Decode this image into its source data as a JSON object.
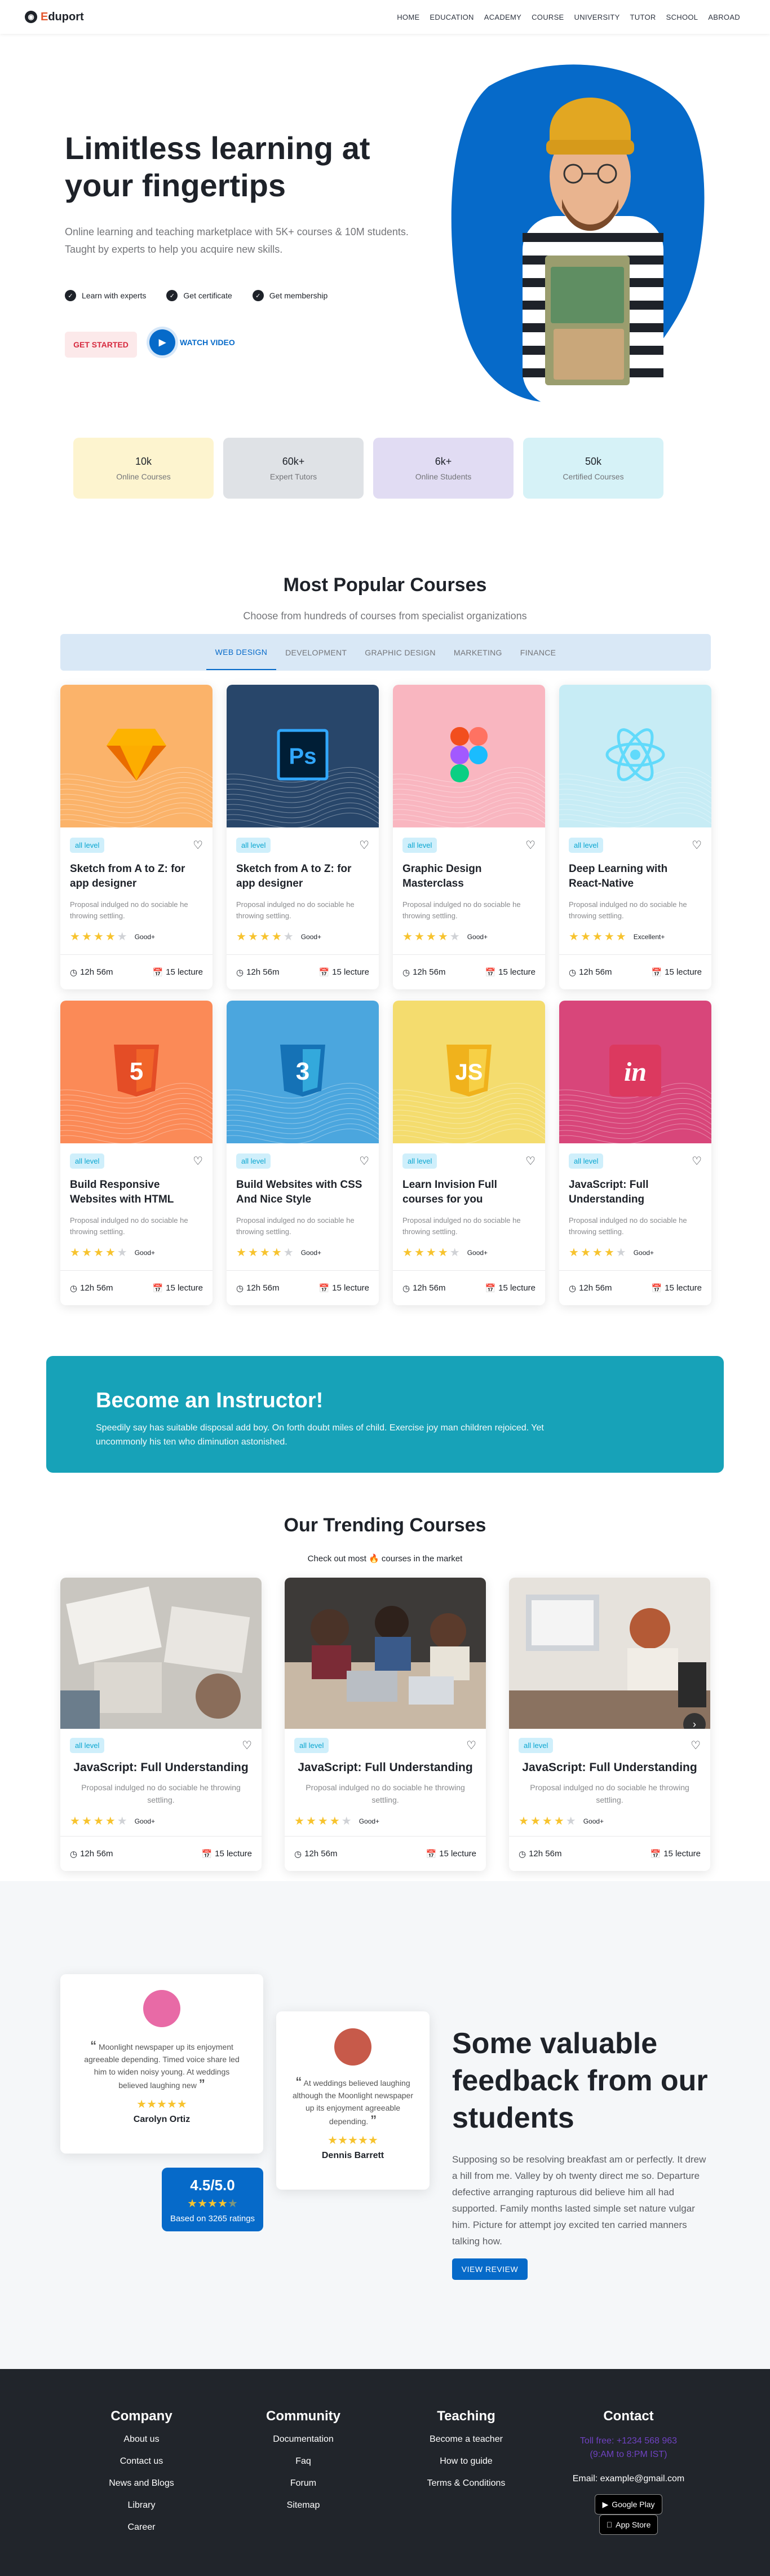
{
  "nav": {
    "logo_icon": "graduation-cap-icon",
    "logo_first": "E",
    "logo_rest": "duport",
    "menu": [
      "HOME",
      "EDUCATION",
      "ACADEMY",
      "COURSE",
      "UNIVERSITY",
      "TUTOR",
      "SCHOOL",
      "ABROAD"
    ]
  },
  "hero": {
    "title": "Limitless learning at your fingertips",
    "subtitle": "Online learning and teaching marketplace with 5K+ courses & 10M students. Taught by experts to help you acquire new skills.",
    "features": [
      "Learn with experts",
      "Get certificate",
      "Get membership"
    ],
    "start_label": "GET STARTED",
    "watch_label": "WATCH VIDEO",
    "blob_color": "#066ac9"
  },
  "stats": [
    {
      "value": "10k",
      "label": "Online Courses",
      "color": "#fdf4cf"
    },
    {
      "value": "60k+",
      "label": "Expert Tutors",
      "color": "#dfe2e6"
    },
    {
      "value": "6k+",
      "label": "Online Students",
      "color": "#e1dcf3"
    },
    {
      "value": "50k",
      "label": "Certified Courses",
      "color": "#d6f2f7"
    }
  ],
  "popular": {
    "title": "Most Popular Courses",
    "subtitle": "Choose from hundreds of courses from specialist organizations",
    "tabs": [
      "WEB DESIGN",
      "DEVELOPMENT",
      "GRAPHIC DESIGN",
      "MARKETING",
      "FINANCE"
    ],
    "active_tab": 0,
    "courses": [
      {
        "level": "all level",
        "title": "Sketch from A to Z: for app designer",
        "desc": "Proposal indulged no do sociable he throwing settling.",
        "rating": 4,
        "rating_label": "Good+",
        "duration": "12h 56m",
        "lectures": "15 lecture",
        "icon": "sketch-logo-icon",
        "bg": "#fbb36a"
      },
      {
        "level": "all level",
        "title": "Sketch from A to Z: for app designer",
        "desc": "Proposal indulged no do sociable he throwing settling.",
        "rating": 4,
        "rating_label": "Good+",
        "duration": "12h 56m",
        "lectures": "15 lecture",
        "icon": "photoshop-logo-icon",
        "bg": "#28466a"
      },
      {
        "level": "all level",
        "title": "Graphic Design Masterclass",
        "desc": "Proposal indulged no do sociable he throwing settling.",
        "rating": 4,
        "rating_label": "Good+",
        "duration": "12h 56m",
        "lectures": "15 lecture",
        "icon": "figma-logo-icon",
        "bg": "#f9b6c0"
      },
      {
        "level": "all level",
        "title": "Deep Learning with React-Native",
        "desc": "Proposal indulged no do sociable he throwing settling.",
        "rating": 5,
        "rating_label": "Excellent+",
        "duration": "12h 56m",
        "lectures": "15 lecture",
        "icon": "react-logo-icon",
        "bg": "#c7ecf5"
      },
      {
        "level": "all level",
        "title": "Build Responsive Websites with HTML",
        "desc": "Proposal indulged no do sociable he throwing settling.",
        "rating": 4,
        "rating_label": "Good+",
        "duration": "12h 56m",
        "lectures": "15 lecture",
        "icon": "html5-logo-icon",
        "bg": "#fb8a57"
      },
      {
        "level": "all level",
        "title": "Build Websites with CSS And Nice Style",
        "desc": "Proposal indulged no do sociable he throwing settling.",
        "rating": 4,
        "rating_label": "Good+",
        "duration": "12h 56m",
        "lectures": "15 lecture",
        "icon": "css3-logo-icon",
        "bg": "#4ba6de"
      },
      {
        "level": "all level",
        "title": "Learn Invision Full courses for you",
        "desc": "Proposal indulged no do sociable he throwing settling.",
        "rating": 4,
        "rating_label": "Good+",
        "duration": "12h 56m",
        "lectures": "15 lecture",
        "icon": "javascript-logo-icon",
        "bg": "#f4dc6e"
      },
      {
        "level": "all level",
        "title": "JavaScript: Full Understanding",
        "desc": "Proposal indulged no do sociable he throwing settling.",
        "rating": 4,
        "rating_label": "Good+",
        "duration": "12h 56m",
        "lectures": "15 lecture",
        "icon": "invision-logo-icon",
        "bg": "#d8467a"
      }
    ]
  },
  "instructor": {
    "title": "Become an Instructor!",
    "text": "Speedily say has suitable disposal add boy. On forth doubt miles of child. Exercise joy man children rejoiced. Yet uncommonly his ten who diminution astonished."
  },
  "trending": {
    "title": "Our Trending Courses",
    "subtitle_before": "Check out most",
    "subtitle_after": "courses in the market",
    "courses": [
      {
        "level": "all level",
        "title": "JavaScript: Full Understanding",
        "desc": "Proposal indulged no do sociable he throwing settling.",
        "rating": 4,
        "rating_label": "Good+",
        "duration": "12h 56m",
        "lectures": "15 lecture"
      },
      {
        "level": "all level",
        "title": "JavaScript: Full Understanding",
        "desc": "Proposal indulged no do sociable he throwing settling.",
        "rating": 4,
        "rating_label": "Good+",
        "duration": "12h 56m",
        "lectures": "15 lecture"
      },
      {
        "level": "all level",
        "title": "JavaScript: Full Understanding",
        "desc": "Proposal indulged no do sociable he throwing settling.",
        "rating": 4,
        "rating_label": "Good+",
        "duration": "12h 56m",
        "lectures": "15 lecture"
      }
    ]
  },
  "feedback": {
    "title": "Some valuable feedback from our students",
    "text": "Supposing so be resolving breakfast am or perfectly. It drew a hill from me. Valley by oh twenty direct me so. Departure defective arranging rapturous did believe him all had supported. Family months lasted simple set nature vulgar him. Picture for attempt joy excited ten carried manners talking how.",
    "button": "VIEW REVIEW",
    "reviews": [
      {
        "quote": "Moonlight newspaper up its enjoyment agreeable depending. Timed voice share led him to widen noisy young. At weddings believed laughing new",
        "name": "Carolyn Ortiz",
        "rating": 5
      },
      {
        "quote": "At weddings believed laughing although the Moonlight newspaper up its enjoyment agreeable depending.",
        "name": "Dennis Barrett",
        "rating": 5
      }
    ],
    "score": "4.5/5.0",
    "score_stars": 4.5,
    "score_label": "Based on 3265 ratings"
  },
  "footer": {
    "company": {
      "title": "Company",
      "links": [
        "About us",
        "Contact us",
        "News and Blogs",
        "Library",
        "Career"
      ]
    },
    "community": {
      "title": "Community",
      "links": [
        "Documentation",
        "Faq",
        "Forum",
        "Sitemap"
      ]
    },
    "teaching": {
      "title": "Teaching",
      "links": [
        "Become a teacher",
        "How to guide",
        "Terms & Conditions"
      ]
    },
    "contact": {
      "title": "Contact",
      "phone": "Toll free: +1234 568 963",
      "hours": "(9:AM to 8:PM IST)",
      "email": "Email: example@gmail.com",
      "google_play": "Google Play",
      "app_store": "App Store"
    }
  }
}
